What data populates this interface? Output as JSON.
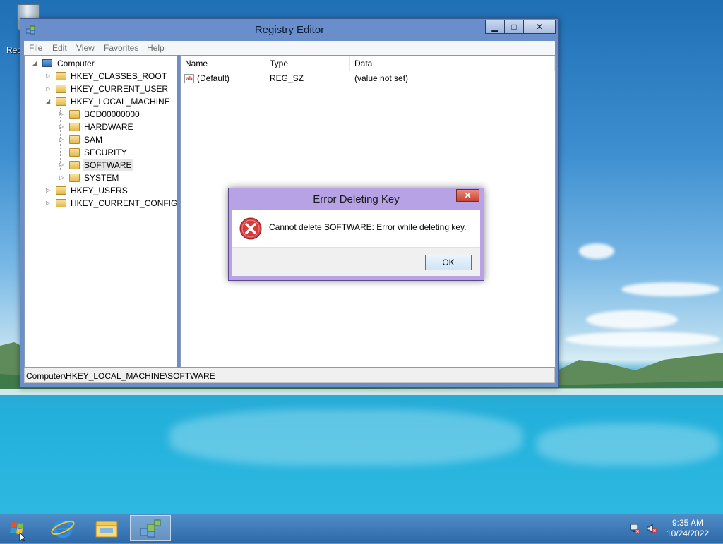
{
  "desktop": {
    "recycle_bin_label": "Rec"
  },
  "window": {
    "title": "Registry Editor",
    "caption": {
      "minimize": "▁",
      "maximize": "□",
      "close": "✕"
    },
    "menu": [
      "File",
      "Edit",
      "View",
      "Favorites",
      "Help"
    ],
    "tree": {
      "root": "Computer",
      "hkey_classes_root": "HKEY_CLASSES_ROOT",
      "hkey_current_user": "HKEY_CURRENT_USER",
      "hkey_local_machine": "HKEY_LOCAL_MACHINE",
      "hklm_children": [
        "BCD00000000",
        "HARDWARE",
        "SAM",
        "SECURITY",
        "SOFTWARE",
        "SYSTEM"
      ],
      "selected": "SOFTWARE",
      "hkey_users": "HKEY_USERS",
      "hkey_current_config": "HKEY_CURRENT_CONFIG"
    },
    "list": {
      "columns": [
        "Name",
        "Type",
        "Data"
      ],
      "rows": [
        {
          "name": "(Default)",
          "type": "REG_SZ",
          "data": "(value not set)",
          "icon": "string-value-icon"
        }
      ]
    },
    "status": "Computer\\HKEY_LOCAL_MACHINE\\SOFTWARE"
  },
  "dialog": {
    "title": "Error Deleting Key",
    "close": "✕",
    "message": "Cannot delete SOFTWARE:  Error while deleting key.",
    "ok_label": "OK",
    "icon": "error-icon"
  },
  "taskbar": {
    "items": [
      "start-button",
      "internet-explorer",
      "file-explorer",
      "registry-editor"
    ],
    "active": "registry-editor",
    "time": "9:35 AM",
    "date": "10/24/2022"
  }
}
